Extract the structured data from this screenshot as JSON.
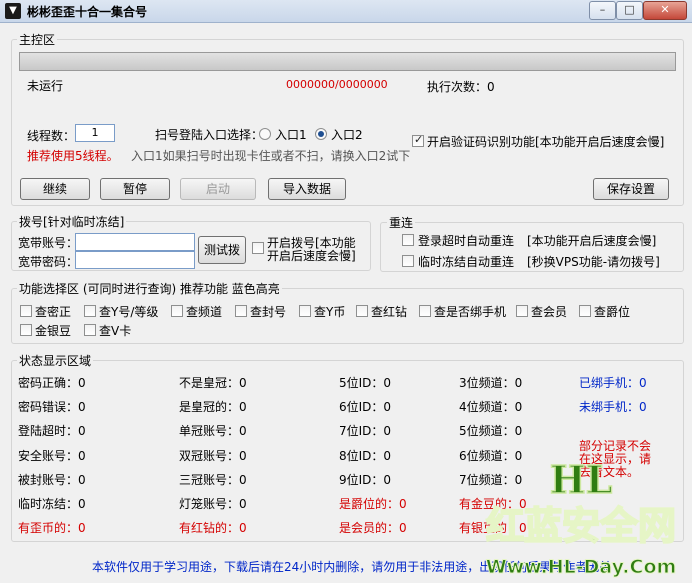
{
  "window": {
    "title": "彬彬歪歪十合一集合号",
    "icon": "app-logo-icon",
    "minimize": "–",
    "maximize": "□",
    "close": "✕"
  },
  "main_area": {
    "title": "主控区",
    "status_left": "未运行",
    "progress_text": "0000000/0000000",
    "exec_label": "执行次数：0",
    "threads_label": "线程数：",
    "threads_value": "1",
    "recommend": "推荐使用5线程。",
    "scan_label": "扫号登陆入口选择：",
    "entry1": "入口1",
    "entry2": "入口2",
    "entry_hint": "入口1如果扫号时出现卡住或者不扫，请换入口2试下",
    "captcha_label": "开启验证码识别功能[本功能开启后速度会慢]",
    "btn_continue": "继续",
    "btn_pause": "暂停",
    "btn_start": "启动",
    "btn_import": "导入数据",
    "btn_save": "保存设置"
  },
  "dial": {
    "title": "拨号[针对临时冻结]",
    "account_label": "宽带账号：",
    "password_label": "宽带密码：",
    "account_value": "",
    "password_value": "",
    "test_btn": "测试拨",
    "enable_line1": "开启拨号[本功能",
    "enable_line2": "开启后速度会慢]"
  },
  "reconnect": {
    "title": "重连",
    "timeout_label": "登录超时自动重连",
    "timeout_note": "[本功能开启后速度会慢]",
    "frozen_label": "临时冻结自动重连",
    "frozen_note": "[秒换VPS功能-请勿拨号]"
  },
  "features": {
    "title": "功能选择区  (可同时进行查询)  推荐功能 蓝色高亮",
    "items": [
      "查密正",
      "查Y号/等级",
      "查频道",
      "查封号",
      "查Y币",
      "查红钻",
      "查是否绑手机",
      "查会员",
      "查爵位",
      "金银豆",
      "查V卡"
    ]
  },
  "status": {
    "title": "状态显示区域",
    "col1": [
      "密码正确：0",
      "密码错误：0",
      "登陆超时：0",
      "安全账号：0",
      "被封账号：0",
      "临时冻结：0",
      "有歪币的：0"
    ],
    "col2": [
      "不是皇冠：0",
      "是皇冠的：0",
      "单冠账号：0",
      "双冠账号：0",
      "三冠账号：0",
      "灯笼账号：0",
      "有红钻的：0"
    ],
    "col3": [
      "5位ID：0",
      "6位ID：0",
      "7位ID：0",
      "8位ID：0",
      "9位ID：0",
      "是爵位的：0",
      "是会员的：0"
    ],
    "col4": [
      "3位频道：0",
      "4位频道：0",
      "5位频道：0",
      "6位频道：0",
      "7位频道：0",
      "有金豆的：0",
      "有银豆的：0"
    ],
    "col5": [
      "已绑手机：0",
      "未绑手机：0"
    ],
    "note_line1": "部分记录不会",
    "note_line2": "在这显示，请",
    "note_line3": "去看文本。"
  },
  "footer": {
    "text": "本软件仅用于学习用途，下载后请在24小时内删除，请勿用于非法用途，出现任何后果与作者无关"
  },
  "watermark": {
    "line1": "HL",
    "line2": "红蓝安全网",
    "line3": "Www.HL-Day.Com"
  }
}
